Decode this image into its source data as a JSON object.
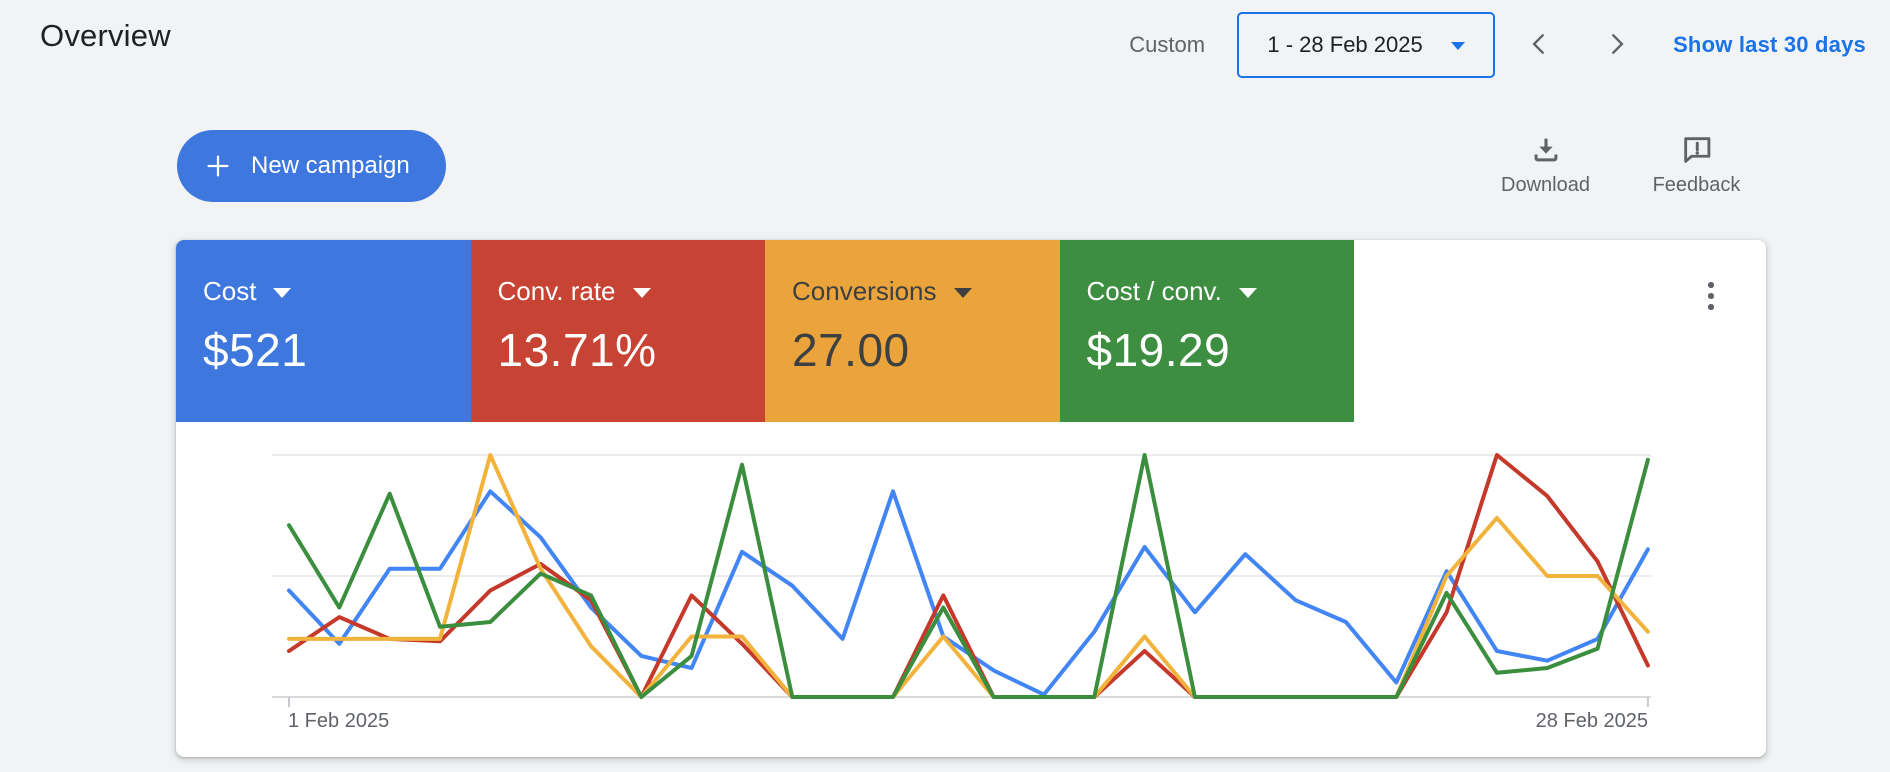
{
  "header": {
    "title": "Overview"
  },
  "date_controls": {
    "custom_label": "Custom",
    "range_value": "1 - 28 Feb 2025",
    "show_last_label": "Show last 30 days"
  },
  "toolbar": {
    "new_campaign_label": "New campaign",
    "download_label": "Download",
    "feedback_label": "Feedback"
  },
  "colors": {
    "accent_blue": "#1a73e8",
    "page_background": "#f1f3f4",
    "panel_background": "#ffffff",
    "text_primary": "#202124",
    "text_secondary": "#5f6368"
  },
  "scorecards": [
    {
      "label": "Cost",
      "value": "$521",
      "color": "#3e77dd",
      "text_color": "#ffffff"
    },
    {
      "label": "Conv. rate",
      "value": "13.71%",
      "color": "#c74333",
      "text_color": "#ffffff"
    },
    {
      "label": "Conversions",
      "value": "27.00",
      "color": "#eba43b",
      "text_color": "#3c4043"
    },
    {
      "label": "Cost / conv.",
      "value": "$19.29",
      "color": "#3e8e41",
      "text_color": "#ffffff"
    }
  ],
  "chart_data": {
    "type": "line",
    "x_axis": {
      "start_label": "1 Feb 2025",
      "end_label": "28 Feb 2025",
      "days": [
        1,
        2,
        3,
        4,
        5,
        6,
        7,
        8,
        9,
        10,
        11,
        12,
        13,
        14,
        15,
        16,
        17,
        18,
        19,
        20,
        21,
        22,
        23,
        24,
        25,
        26,
        27,
        28
      ]
    },
    "y_axis": {
      "tick_labels_visible": false,
      "gridlines": 3,
      "scale_note": "values are percent of plot height; baseline = 0, top gridline = 100"
    },
    "legend": "none (line colors match scorecards)",
    "series": [
      {
        "name": "Cost",
        "color": "#4285f4",
        "values": [
          44,
          22,
          53,
          53,
          85,
          66,
          37,
          17,
          12,
          60,
          46,
          24,
          85,
          25,
          11,
          1,
          27,
          62,
          35,
          59,
          40,
          31,
          6,
          52,
          19,
          15,
          24,
          61
        ]
      },
      {
        "name": "Conv. rate",
        "color": "#c5392b",
        "values": [
          19,
          33,
          24,
          23,
          44,
          55,
          40,
          0,
          42,
          22,
          0,
          0,
          0,
          42,
          0,
          0,
          0,
          19,
          0,
          0,
          0,
          0,
          0,
          35,
          100,
          83,
          56,
          13
        ]
      },
      {
        "name": "Conversions",
        "color": "#f2b33c",
        "values": [
          24,
          24,
          24,
          24,
          100,
          53,
          21,
          0,
          25,
          25,
          0,
          0,
          0,
          25,
          0,
          0,
          0,
          25,
          0,
          0,
          0,
          0,
          0,
          50,
          74,
          50,
          50,
          27
        ]
      },
      {
        "name": "Cost / conv.",
        "color": "#3a8e3d",
        "values": [
          71,
          37,
          84,
          29,
          31,
          51,
          42,
          0,
          17,
          96,
          0,
          0,
          0,
          37,
          0,
          0,
          0,
          100,
          0,
          0,
          0,
          0,
          0,
          43,
          10,
          12,
          20,
          98
        ]
      }
    ]
  }
}
